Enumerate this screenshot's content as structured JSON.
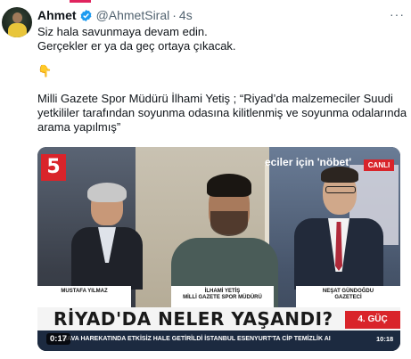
{
  "tweet": {
    "author_name": "Ahmet",
    "author_handle": "@AhmetSiral",
    "separator": "·",
    "timestamp": "4s",
    "more_label": "···",
    "lines": [
      "Siz hala savunmaya devam edin.",
      "Gerçekler er ya da geç ortaya çıkacak.",
      "Milli Gazete Spor Müdürü İlhami Yetiş ; “Riyad’da malzemeciler Suudi",
      "yetkililer tarafından soyunma odasına kilitlenmiş ve soyunma odalarında",
      "arama yapılmış”"
    ],
    "emoji": "👇"
  },
  "video": {
    "channel_logo": "5",
    "live_badge": "CANLI",
    "background_text": "eciler için 'nöbet'",
    "guests": [
      {
        "name": "MUSTAFA YILMAZ",
        "title": ""
      },
      {
        "name": "İLHAMİ YETİŞ",
        "title": "MİLLİ GAZETE SPOR MÜDÜRÜ"
      },
      {
        "name": "NEŞAT GÜNDOĞDU",
        "title": "GAZETECİ"
      }
    ],
    "headline": "RİYAD'DA NELER YAŞANDI?",
    "program": "4. GÜÇ",
    "ticker": "HAVA HAREKATINDA ETKİSİZ HALE GETİRİLDİ    İSTANBUL ESENYURT'TA CİP TEMİZLİK AI",
    "clock": "10:18",
    "duration": "0:17"
  },
  "colors": {
    "accent_red": "#d9242a",
    "verified_blue": "#1d9bf0",
    "muted_text": "#536471"
  },
  "icons": [
    "verified-badge-icon",
    "more-options-icon"
  ]
}
